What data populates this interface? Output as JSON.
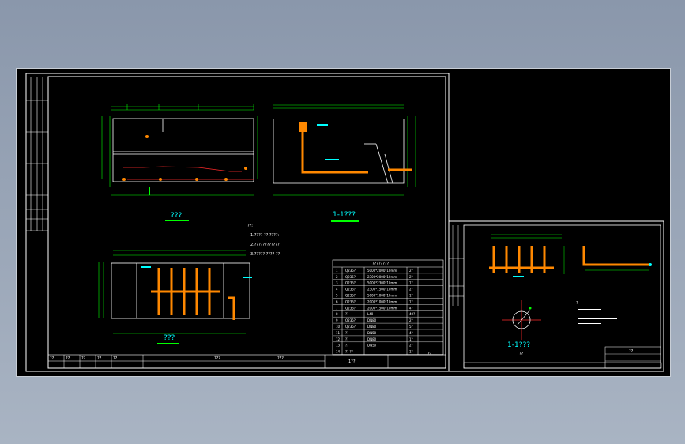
{
  "drawing": {
    "views": {
      "plan_title": "???",
      "side_title": "???",
      "section_title": "1-1???",
      "right_section_title": "1-1???",
      "right_sub_title": "??"
    },
    "notes": {
      "heading": "??:",
      "lines": [
        "1.???? ?? ????:",
        "2.????????????",
        "3.????? ???? ??"
      ]
    },
    "right_notes_heading": "?",
    "table": {
      "title": "????????",
      "rows": [
        {
          "no": "1",
          "spec": "Q235?",
          "size": "5000*2000*10mm",
          "qty": "2?"
        },
        {
          "no": "2",
          "spec": "Q235?",
          "size": "2300*2000*10mm",
          "qty": "2?"
        },
        {
          "no": "3",
          "spec": "Q235?",
          "size": "5000*2300*10mm",
          "qty": "1?"
        },
        {
          "no": "4",
          "spec": "Q235?",
          "size": "2300*1500*10mm",
          "qty": "2?"
        },
        {
          "no": "5",
          "spec": "Q235?",
          "size": "5000*1000*10mm",
          "qty": "1?"
        },
        {
          "no": "6",
          "spec": "Q235?",
          "size": "2000*1000*10mm",
          "qty": "1?"
        },
        {
          "no": "7",
          "spec": "Q235?",
          "size": "2000*1500*10mm",
          "qty": "4?"
        },
        {
          "no": "8",
          "spec": "??",
          "size": "L40",
          "qty": "40?"
        },
        {
          "no": "9",
          "spec": "Q235?",
          "size": "DN80",
          "qty": "2?"
        },
        {
          "no": "10",
          "spec": "Q235?",
          "size": "DN80",
          "qty": "5?"
        },
        {
          "no": "11",
          "spec": "??",
          "size": "DN50",
          "qty": "4?"
        },
        {
          "no": "12",
          "spec": "??",
          "size": "DN80",
          "qty": "1?"
        },
        {
          "no": "13",
          "spec": "??",
          "size": "DN50",
          "qty": "2?"
        },
        {
          "no": "14",
          "spec": "?? ??",
          "size": "",
          "qty": "1?"
        }
      ]
    },
    "title_block": {
      "left_cells": [
        "??",
        "??",
        "??",
        "??",
        "??"
      ],
      "center_label": "???",
      "right_label": "???",
      "drawing_no": "1??",
      "scale": "??"
    },
    "right_title_block": {
      "label": "??"
    }
  }
}
